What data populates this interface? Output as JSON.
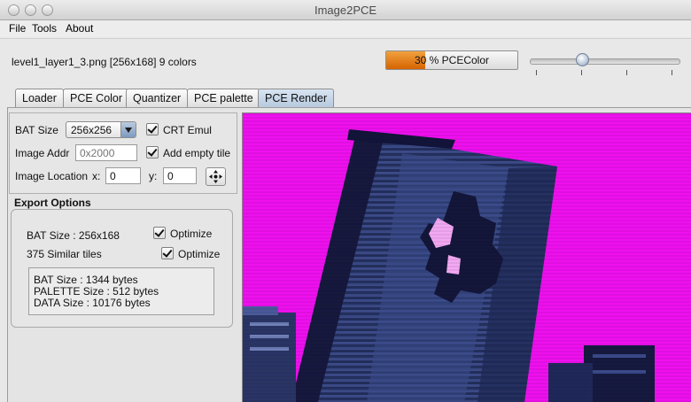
{
  "window": {
    "title": "Image2PCE"
  },
  "menu": [
    "File",
    "Tools",
    "About"
  ],
  "info": {
    "file_info": "level1_layer1_3.png [256x168] 9 colors",
    "progress_text": "30 % PCEColor",
    "progress_fraction": 0.3,
    "slider_fraction": 0.35
  },
  "tabs": [
    {
      "label": "Loader",
      "active": false
    },
    {
      "label": "PCE Color",
      "active": false
    },
    {
      "label": "Quantizer",
      "active": false
    },
    {
      "label": "PCE palette",
      "active": false
    },
    {
      "label": "PCE Render",
      "active": true
    }
  ],
  "settings": {
    "bat_size_label": "BAT Size",
    "bat_size_value": "256x256",
    "crt_emul_label": "CRT Emul",
    "image_addr_label": "Image Addr",
    "image_addr_placeholder": "0x2000",
    "add_empty_tile_label": "Add empty tile",
    "image_location_label": "Image Location",
    "x_label": "x:",
    "x_value": "0",
    "y_label": "y:",
    "y_value": "0"
  },
  "export": {
    "title": "Export Options",
    "bat_size_text": "BAT Size : 256x168",
    "optimize_label_1": "Optimize",
    "similar_tiles_text": "375 Similar tiles",
    "optimize_label_2": "Optimize",
    "sizes": [
      "BAT Size : 1344 bytes",
      "PALETTE Size : 512 bytes",
      "DATA Size : 10176 bytes"
    ]
  },
  "colors": {
    "render_background": "#ee10ee",
    "progress_orange": "#e07a12",
    "active_tab": "#c6d5e7"
  }
}
